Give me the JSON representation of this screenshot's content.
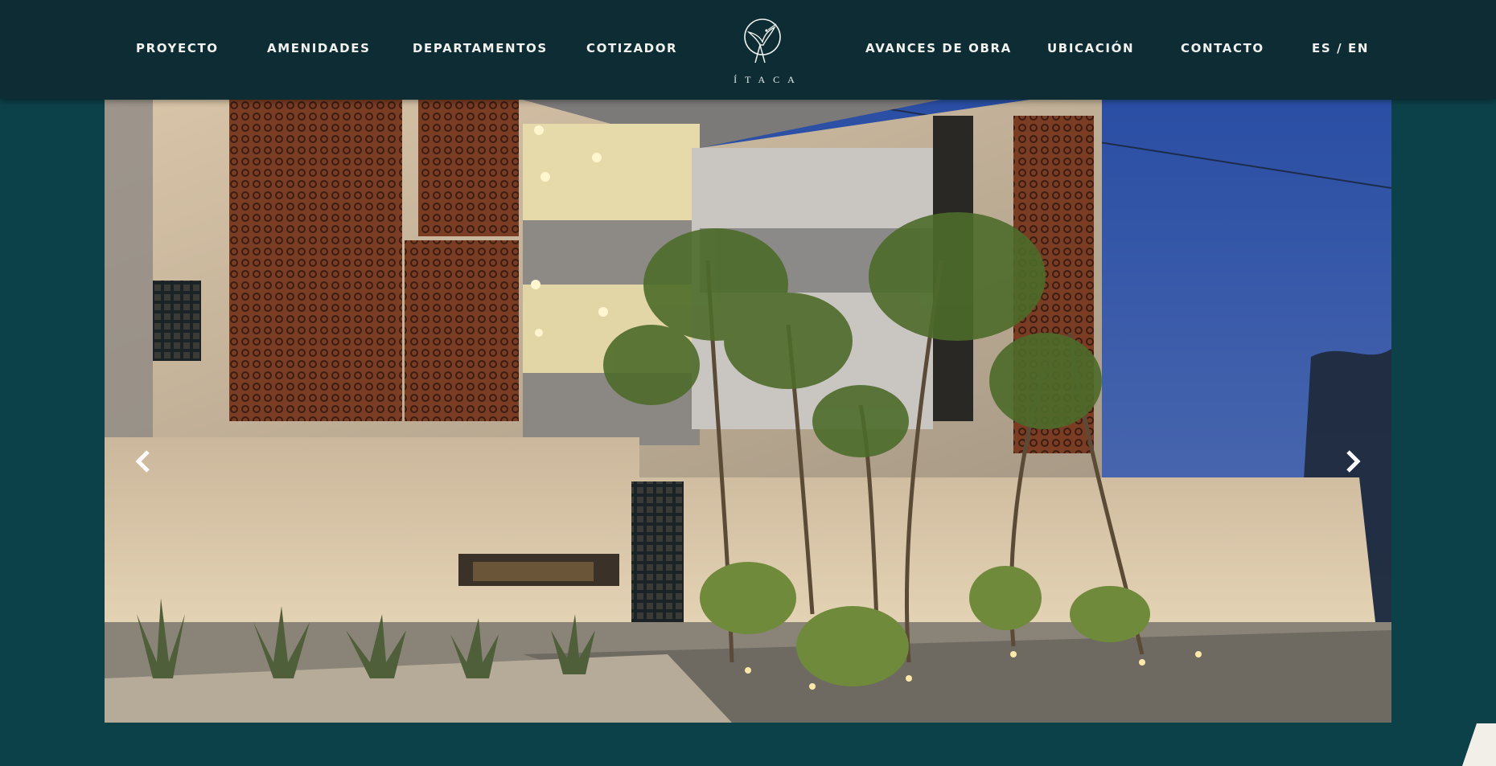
{
  "nav": {
    "left": [
      {
        "label": "PROYECTO"
      },
      {
        "label": "AMENIDADES"
      },
      {
        "label": "DEPARTAMENTOS"
      },
      {
        "label": "COTIZADOR"
      }
    ],
    "right": [
      {
        "label": "AVANCES DE OBRA"
      },
      {
        "label": "UBICACIÓN"
      },
      {
        "label": "CONTACTO"
      },
      {
        "label": "ES / EN"
      }
    ]
  },
  "logo": {
    "text": "ÍTACA",
    "icon": "hummingbird-icon"
  },
  "slider": {
    "prev_icon": "chevron-left-icon",
    "next_icon": "chevron-right-icon"
  },
  "colors": {
    "header_bg": "#0d2c34",
    "page_bg": "#0c4149",
    "nav_text": "#f1f1ee",
    "sky": "#2a4a8f",
    "wall": "#c9b497",
    "brick": "#7a3d24"
  }
}
